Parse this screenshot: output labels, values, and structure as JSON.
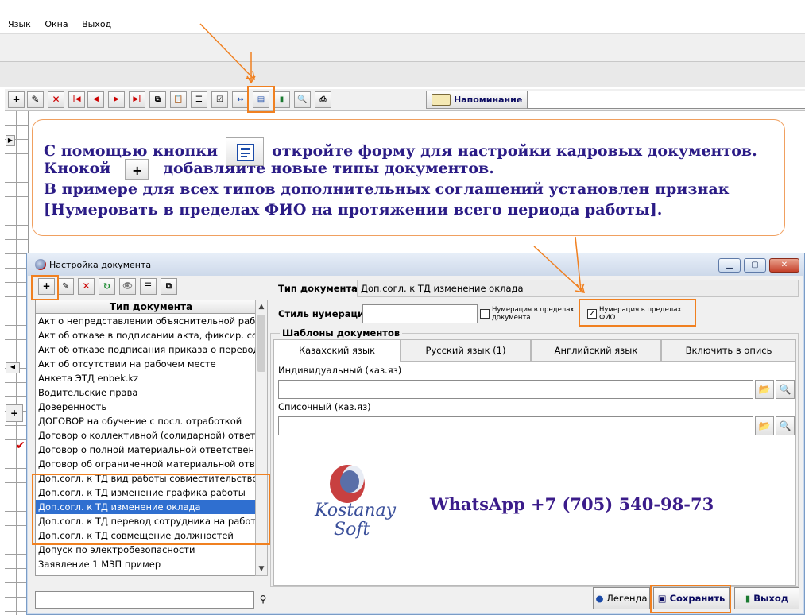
{
  "menu": {
    "items": [
      "Язык",
      "Окна",
      "Выход"
    ]
  },
  "toolbar": {
    "reminder_label": "Напоминание"
  },
  "callout": {
    "line1_before": "С помощью кнопки",
    "line1_after": "откройте форму для настройки кадровых документов.",
    "line2_before": "Кнокой",
    "line2_after": "добавляйте новые типы документов.",
    "line3": "В примере для всех типов дополнительных соглашений установлен признак",
    "line4": "[Нумеровать в пределах ФИО на протяжении всего периода работы]."
  },
  "dialog": {
    "title": "Настройка документа",
    "list_header": "Тип документа",
    "items": [
      "Акт о непредставлении объяснительной работн",
      "Акт об отказе в подписании акта, фиксир. совер",
      "Акт об отказе подписания приказа о переводе н",
      "Акт об отсутствии на рабочем месте",
      "Анкета ЭТД enbek.kz",
      "Водительские права",
      "Доверенность",
      "ДОГОВОР на обучение с посл. отработкой",
      "Договор о коллективной (солидарной) ответствен",
      "Договор о полной материальной ответственности",
      "Договор об ограниченной материальной ответст",
      "Доп.согл. к ТД вид работы совместительство на",
      "Доп.согл. к ТД изменение графика работы",
      "Доп.согл. к ТД изменение оклада",
      "Доп.согл. к ТД перевод сотрудника на работу в д",
      "Доп.согл. к ТД совмещение должностей",
      "Допуск по электробезопасности",
      "Заявление 1 МЗП пример"
    ],
    "selected_index": 13,
    "doc_type_label": "Тип документа",
    "doc_type_value": "Доп.согл. к ТД изменение оклада",
    "numstyle_label": "Стиль нумерации",
    "numstyle_value": "",
    "cb1_label": "Нумерация в пределах документа",
    "cb1_checked": false,
    "cb2_label": "Нумерация в пределах ФИО",
    "cb2_checked": true,
    "templates_legend": "Шаблоны документов",
    "tabs": [
      "Казахский язык",
      "Русский язык (1)",
      "Английский язык",
      "Включить в опись"
    ],
    "active_tab": 0,
    "field1_label": "Индивидуальный (каз.яз)",
    "field1_value": "",
    "field2_label": "Списочный (каз.яз)",
    "field2_value": "",
    "logo_text1": "Kostanay",
    "logo_text2": "Soft",
    "whatsapp": "WhatsApp  +7 (705) 540-98-73",
    "btn_legend": "Легенда",
    "btn_save": "Сохранить",
    "btn_exit": "Выход"
  },
  "colors": {
    "accent_orange": "#f08020",
    "callout_text": "#2b1c86",
    "selection": "#2f6fd0"
  }
}
